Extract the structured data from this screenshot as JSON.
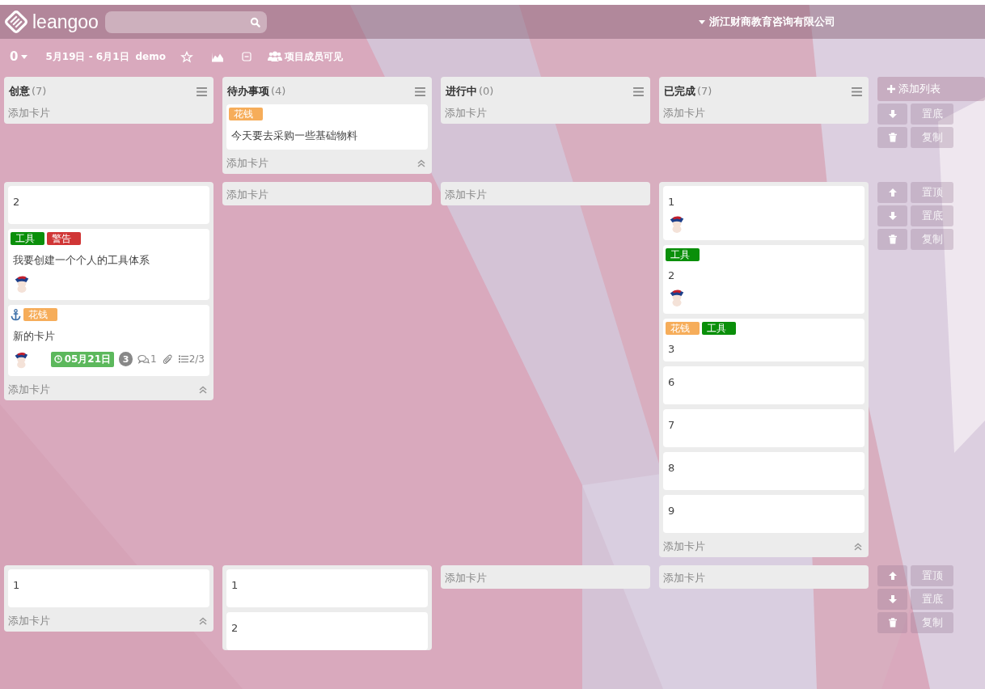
{
  "header": {
    "logo": "leangoo",
    "organization": "浙江财商教育咨询有限公司"
  },
  "toolbar": {
    "count": "0",
    "dates": "5月19日 - 6月1日",
    "board_name": "demo",
    "visibility": "项目成员可见"
  },
  "lists": [
    {
      "name": "创意",
      "count": "(7)"
    },
    {
      "name": "待办事项",
      "count": "(4)"
    },
    {
      "name": "进行中",
      "count": "(0)"
    },
    {
      "name": "已完成",
      "count": "(7)"
    }
  ],
  "lanes": [
    {
      "add_list": "添加列表",
      "actions": [
        {
          "kind": "down",
          "label": "置底"
        },
        {
          "kind": "delete",
          "label": "复制"
        }
      ],
      "cells": [
        {
          "add_label": "添加卡片"
        },
        {
          "cards": [
            {
              "labels": [
                {
                  "text": "花钱",
                  "color": "#f6ad5a"
                }
              ],
              "title": "今天要去采购一些基础物料"
            }
          ],
          "add_label": "添加卡片",
          "collapse": true
        },
        {
          "add_label": "添加卡片"
        },
        {
          "add_label": "添加卡片"
        }
      ]
    },
    {
      "actions": [
        {
          "kind": "up",
          "label": "置顶"
        },
        {
          "kind": "down",
          "label": "置底"
        },
        {
          "kind": "delete",
          "label": "复制"
        }
      ],
      "cells": [
        {
          "cards": [
            {
              "title": "2"
            },
            {
              "labels": [
                {
                  "text": "工具",
                  "color": "#0a8f0a"
                },
                {
                  "text": "警告",
                  "color": "#d03535"
                }
              ],
              "title": "我要创建一个个人的工具体系",
              "avatar": true
            },
            {
              "labels": [
                {
                  "text": "花钱",
                  "color": "#f6ad5a"
                }
              ],
              "title": "新的卡片",
              "avatar": true,
              "anchor": true,
              "badges": {
                "due": "05月21日",
                "count": "3",
                "comments": "1",
                "attachment": true,
                "checklist": "2/3"
              }
            }
          ],
          "add_label": "添加卡片",
          "collapse": true
        },
        {
          "add_label": "添加卡片"
        },
        {
          "add_label": "添加卡片"
        },
        {
          "cards": [
            {
              "title": "1",
              "avatar": true
            },
            {
              "labels": [
                {
                  "text": "工具",
                  "color": "#0a8f0a"
                }
              ],
              "title": "2",
              "avatar": true
            },
            {
              "labels": [
                {
                  "text": "花钱",
                  "color": "#f6ad5a"
                },
                {
                  "text": "工具",
                  "color": "#0a8f0a"
                }
              ],
              "title": "3"
            },
            {
              "title": "6"
            },
            {
              "title": "7"
            },
            {
              "title": "8"
            },
            {
              "title": "9"
            }
          ],
          "add_label": "添加卡片",
          "collapse": true
        }
      ]
    },
    {
      "actions": [
        {
          "kind": "up",
          "label": "置顶"
        },
        {
          "kind": "down",
          "label": "置底"
        },
        {
          "kind": "delete",
          "label": "复制"
        }
      ],
      "cells": [
        {
          "cards": [
            {
              "title": "1"
            }
          ],
          "add_label": "添加卡片",
          "collapse": true
        },
        {
          "cards": [
            {
              "title": "1"
            },
            {
              "title": "2"
            }
          ]
        },
        {
          "add_label": "添加卡片"
        },
        {
          "add_label": "添加卡片"
        }
      ]
    }
  ]
}
